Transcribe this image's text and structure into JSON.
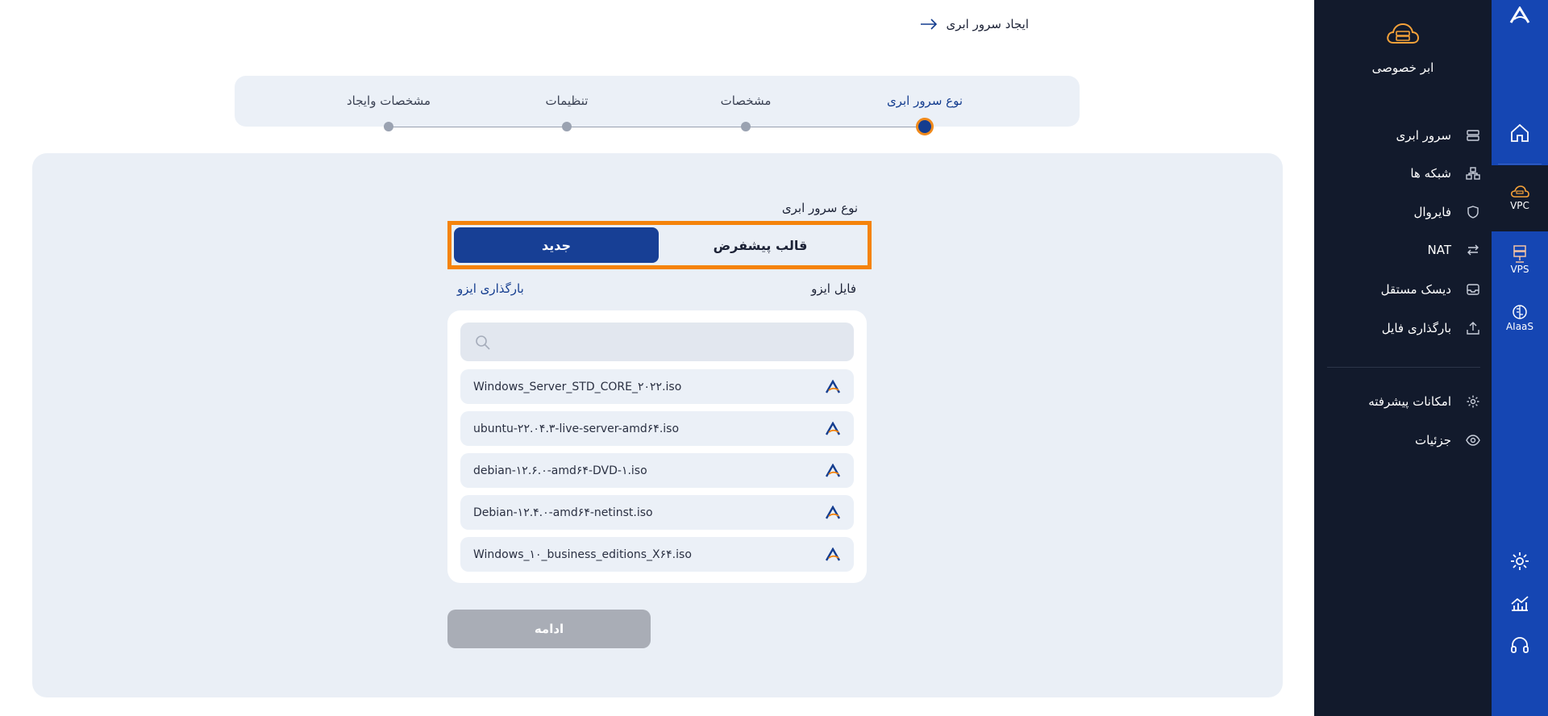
{
  "header": {
    "back_label": "ایجاد سرور ابری"
  },
  "stepper": {
    "steps": [
      {
        "label": "نوع سرور ابری",
        "active": true
      },
      {
        "label": "مشخصات",
        "active": false
      },
      {
        "label": "تنظیمات",
        "active": false
      },
      {
        "label": "مشخصات وایجاد",
        "active": false
      }
    ]
  },
  "form": {
    "type_title": "نوع سرور ابری",
    "tab_default": "قالب پیشفرض",
    "tab_new": "جدید",
    "selected_tab": "جدید",
    "iso_label": "فایل ایزو",
    "upload_iso": "بارگذاری ایزو",
    "search": {
      "placeholder": "",
      "icon": "search-icon"
    },
    "iso_files": [
      "Windows_Server_STD_CORE_۲۰۲۲.iso",
      "ubuntu-۲۲.۰۴.۳-live-server-amd۶۴.iso",
      "debian-۱۲.۶.۰-amd۶۴-DVD-۱.iso",
      "Debian-۱۲.۴.۰-amd۶۴-netinst.iso",
      "Windows_۱۰_business_editions_X۶۴.iso"
    ],
    "continue_label": "ادامه"
  },
  "sidebar": {
    "title": "ابر خصوصی",
    "items": [
      {
        "label": "سرور ابری",
        "icon": "server-icon"
      },
      {
        "label": "شبکه ها",
        "icon": "network-icon"
      },
      {
        "label": "فایروال",
        "icon": "shield-icon"
      },
      {
        "label": "NAT",
        "icon": "arrows-icon"
      },
      {
        "label": "دیسک مستقل",
        "icon": "disk-icon"
      },
      {
        "label": "بارگذاری فایل",
        "icon": "upload-icon"
      }
    ],
    "extra_items": [
      {
        "label": "امکانات پیشرفته",
        "icon": "gear-icon"
      },
      {
        "label": "جزئیات",
        "icon": "eye-icon"
      }
    ]
  },
  "rail": {
    "items": [
      {
        "label": "VPC",
        "icon": "cloud-server-icon"
      },
      {
        "label": "VPS",
        "icon": "vps-icon"
      },
      {
        "label": "AIaaS",
        "icon": "ai-brain-icon"
      }
    ],
    "bottom_icons": [
      "settings-icon",
      "chart-icon",
      "support-icon"
    ]
  },
  "colors": {
    "primary": "#173f95",
    "accent": "#f5830b",
    "sidebar": "#121a2c",
    "rail": "#1546b3",
    "panel": "#eaeff6"
  }
}
